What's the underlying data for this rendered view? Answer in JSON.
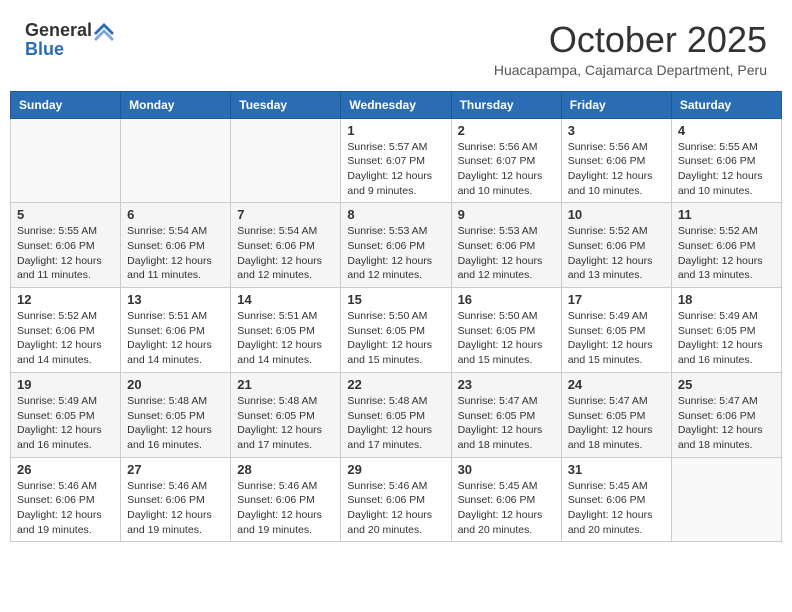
{
  "logo": {
    "general": "General",
    "blue": "Blue"
  },
  "header": {
    "month": "October 2025",
    "subtitle": "Huacapampa, Cajamarca Department, Peru"
  },
  "weekdays": [
    "Sunday",
    "Monday",
    "Tuesday",
    "Wednesday",
    "Thursday",
    "Friday",
    "Saturday"
  ],
  "weeks": [
    [
      {
        "day": "",
        "info": ""
      },
      {
        "day": "",
        "info": ""
      },
      {
        "day": "",
        "info": ""
      },
      {
        "day": "1",
        "info": "Sunrise: 5:57 AM\nSunset: 6:07 PM\nDaylight: 12 hours\nand 9 minutes."
      },
      {
        "day": "2",
        "info": "Sunrise: 5:56 AM\nSunset: 6:07 PM\nDaylight: 12 hours\nand 10 minutes."
      },
      {
        "day": "3",
        "info": "Sunrise: 5:56 AM\nSunset: 6:06 PM\nDaylight: 12 hours\nand 10 minutes."
      },
      {
        "day": "4",
        "info": "Sunrise: 5:55 AM\nSunset: 6:06 PM\nDaylight: 12 hours\nand 10 minutes."
      }
    ],
    [
      {
        "day": "5",
        "info": "Sunrise: 5:55 AM\nSunset: 6:06 PM\nDaylight: 12 hours\nand 11 minutes."
      },
      {
        "day": "6",
        "info": "Sunrise: 5:54 AM\nSunset: 6:06 PM\nDaylight: 12 hours\nand 11 minutes."
      },
      {
        "day": "7",
        "info": "Sunrise: 5:54 AM\nSunset: 6:06 PM\nDaylight: 12 hours\nand 12 minutes."
      },
      {
        "day": "8",
        "info": "Sunrise: 5:53 AM\nSunset: 6:06 PM\nDaylight: 12 hours\nand 12 minutes."
      },
      {
        "day": "9",
        "info": "Sunrise: 5:53 AM\nSunset: 6:06 PM\nDaylight: 12 hours\nand 12 minutes."
      },
      {
        "day": "10",
        "info": "Sunrise: 5:52 AM\nSunset: 6:06 PM\nDaylight: 12 hours\nand 13 minutes."
      },
      {
        "day": "11",
        "info": "Sunrise: 5:52 AM\nSunset: 6:06 PM\nDaylight: 12 hours\nand 13 minutes."
      }
    ],
    [
      {
        "day": "12",
        "info": "Sunrise: 5:52 AM\nSunset: 6:06 PM\nDaylight: 12 hours\nand 14 minutes."
      },
      {
        "day": "13",
        "info": "Sunrise: 5:51 AM\nSunset: 6:06 PM\nDaylight: 12 hours\nand 14 minutes."
      },
      {
        "day": "14",
        "info": "Sunrise: 5:51 AM\nSunset: 6:05 PM\nDaylight: 12 hours\nand 14 minutes."
      },
      {
        "day": "15",
        "info": "Sunrise: 5:50 AM\nSunset: 6:05 PM\nDaylight: 12 hours\nand 15 minutes."
      },
      {
        "day": "16",
        "info": "Sunrise: 5:50 AM\nSunset: 6:05 PM\nDaylight: 12 hours\nand 15 minutes."
      },
      {
        "day": "17",
        "info": "Sunrise: 5:49 AM\nSunset: 6:05 PM\nDaylight: 12 hours\nand 15 minutes."
      },
      {
        "day": "18",
        "info": "Sunrise: 5:49 AM\nSunset: 6:05 PM\nDaylight: 12 hours\nand 16 minutes."
      }
    ],
    [
      {
        "day": "19",
        "info": "Sunrise: 5:49 AM\nSunset: 6:05 PM\nDaylight: 12 hours\nand 16 minutes."
      },
      {
        "day": "20",
        "info": "Sunrise: 5:48 AM\nSunset: 6:05 PM\nDaylight: 12 hours\nand 16 minutes."
      },
      {
        "day": "21",
        "info": "Sunrise: 5:48 AM\nSunset: 6:05 PM\nDaylight: 12 hours\nand 17 minutes."
      },
      {
        "day": "22",
        "info": "Sunrise: 5:48 AM\nSunset: 6:05 PM\nDaylight: 12 hours\nand 17 minutes."
      },
      {
        "day": "23",
        "info": "Sunrise: 5:47 AM\nSunset: 6:05 PM\nDaylight: 12 hours\nand 18 minutes."
      },
      {
        "day": "24",
        "info": "Sunrise: 5:47 AM\nSunset: 6:05 PM\nDaylight: 12 hours\nand 18 minutes."
      },
      {
        "day": "25",
        "info": "Sunrise: 5:47 AM\nSunset: 6:06 PM\nDaylight: 12 hours\nand 18 minutes."
      }
    ],
    [
      {
        "day": "26",
        "info": "Sunrise: 5:46 AM\nSunset: 6:06 PM\nDaylight: 12 hours\nand 19 minutes."
      },
      {
        "day": "27",
        "info": "Sunrise: 5:46 AM\nSunset: 6:06 PM\nDaylight: 12 hours\nand 19 minutes."
      },
      {
        "day": "28",
        "info": "Sunrise: 5:46 AM\nSunset: 6:06 PM\nDaylight: 12 hours\nand 19 minutes."
      },
      {
        "day": "29",
        "info": "Sunrise: 5:46 AM\nSunset: 6:06 PM\nDaylight: 12 hours\nand 20 minutes."
      },
      {
        "day": "30",
        "info": "Sunrise: 5:45 AM\nSunset: 6:06 PM\nDaylight: 12 hours\nand 20 minutes."
      },
      {
        "day": "31",
        "info": "Sunrise: 5:45 AM\nSunset: 6:06 PM\nDaylight: 12 hours\nand 20 minutes."
      },
      {
        "day": "",
        "info": ""
      }
    ]
  ]
}
